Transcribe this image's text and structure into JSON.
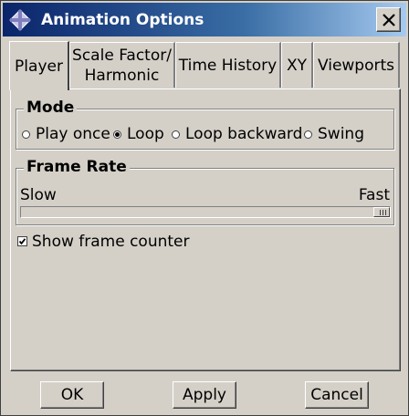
{
  "window": {
    "title": "Animation Options"
  },
  "tabs": [
    {
      "label": "Player",
      "active": true
    },
    {
      "label": "Scale Factor/\nHarmonic",
      "active": false
    },
    {
      "label": "Time History",
      "active": false
    },
    {
      "label": "XY",
      "active": false
    },
    {
      "label": "Viewports",
      "active": false
    }
  ],
  "mode": {
    "legend": "Mode",
    "options": [
      "Play once",
      "Loop",
      "Loop backward",
      "Swing"
    ],
    "selected": "Loop"
  },
  "frame_rate": {
    "legend": "Frame Rate",
    "min_label": "Slow",
    "max_label": "Fast",
    "value_fraction": 1.0
  },
  "show_frame_counter": {
    "label": "Show frame counter",
    "checked": true
  },
  "buttons": {
    "ok": "OK",
    "apply": "Apply",
    "cancel": "Cancel"
  }
}
